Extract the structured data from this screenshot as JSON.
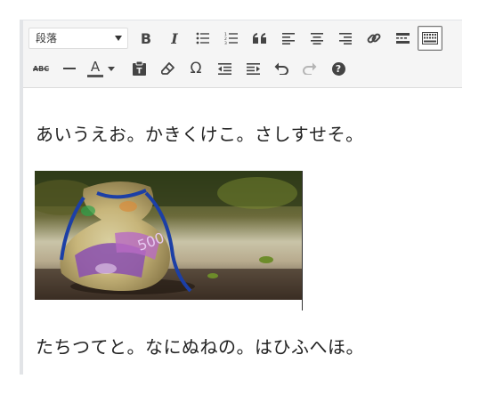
{
  "toolbar": {
    "format_select": {
      "value": "段落"
    },
    "row1_icons": [
      "bold-icon",
      "italic-icon",
      "bullet-list-icon",
      "numbered-list-icon",
      "blockquote-icon",
      "align-left-icon",
      "align-center-icon",
      "align-right-icon",
      "link-icon",
      "read-more-icon",
      "toolbar-toggle-icon"
    ],
    "row2_icons": [
      "strikethrough-icon",
      "horizontal-line-icon",
      "text-color-icon",
      "paste-as-text-icon",
      "clear-formatting-icon",
      "special-character-icon",
      "outdent-icon",
      "indent-icon",
      "undo-icon",
      "redo-icon",
      "help-icon"
    ],
    "bold_label": "B",
    "italic_label": "I",
    "abc_label": "ABC",
    "text_color_label": "A",
    "omega_label": "Ω",
    "help_label": "?"
  },
  "content": {
    "paragraph1": "あいうえお。かきくけこ。さしすせそ。",
    "image_alt": "money-bag-photo",
    "paragraph2": "たちつてと。なにぬねの。はひふへほ。"
  },
  "colors": {
    "toolbar_bg": "#f5f5f5",
    "icon": "#444444",
    "text_color_bar": "#555555"
  }
}
